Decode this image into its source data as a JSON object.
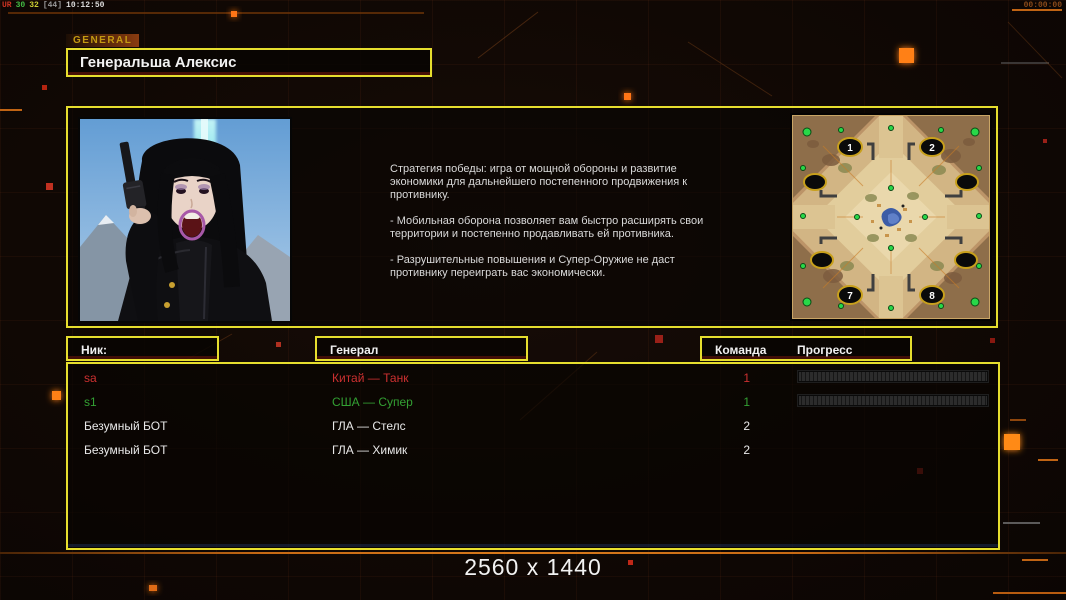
{
  "hud": {
    "stats": [
      {
        "text": "UR",
        "color": "#cc3322"
      },
      {
        "text": "30",
        "color": "#44bb44"
      },
      {
        "text": "32",
        "color": "#cccc33"
      },
      {
        "text": "[44]",
        "color": "#999999"
      },
      {
        "text": "10:12:50",
        "color": "#dddddd"
      }
    ],
    "timer": "00:00:00"
  },
  "general": {
    "tag": "GENERAL",
    "name": "Генеральша Алексис",
    "strategy": [
      "Стратегия победы: игра от мощной обороны и развитие экономики для дальнейшего постепенного продвижения к противнику.",
      "- Мобильная оборона позволяет вам быстро расширять свои территории и постепенно продавливать ей противника.",
      "- Разрушительные повышения и Супер-Оружие не даст противнику переиграть вас экономически."
    ]
  },
  "minimap": {
    "start_positions": [
      "1",
      "2",
      "7",
      "8"
    ]
  },
  "lobby": {
    "columns": {
      "nick": "Ник:",
      "general": "Генерал",
      "team": "Команда",
      "progress": "Прогресс"
    },
    "players": [
      {
        "nick": "sa",
        "general": "Китай — Танк",
        "team": "1",
        "color": "#cc3030",
        "progress": true
      },
      {
        "nick": "s1",
        "general": "США — Супер",
        "team": "1",
        "color": "#33a033",
        "progress": true
      },
      {
        "nick": "Безумный БОТ",
        "general": "ГЛА — Стелс",
        "team": "2",
        "color": "#e8e8e8",
        "progress": false
      },
      {
        "nick": "Безумный БОТ",
        "general": "ГЛА — Химик",
        "team": "2",
        "color": "#e8e8e8",
        "progress": false
      }
    ]
  },
  "footer": {
    "resolution": "2560 x 1440"
  },
  "colors": {
    "accent_yellow": "#e6de2e",
    "hud_orange": "#c06414",
    "player_red": "#cc3030",
    "player_green": "#33a033"
  }
}
